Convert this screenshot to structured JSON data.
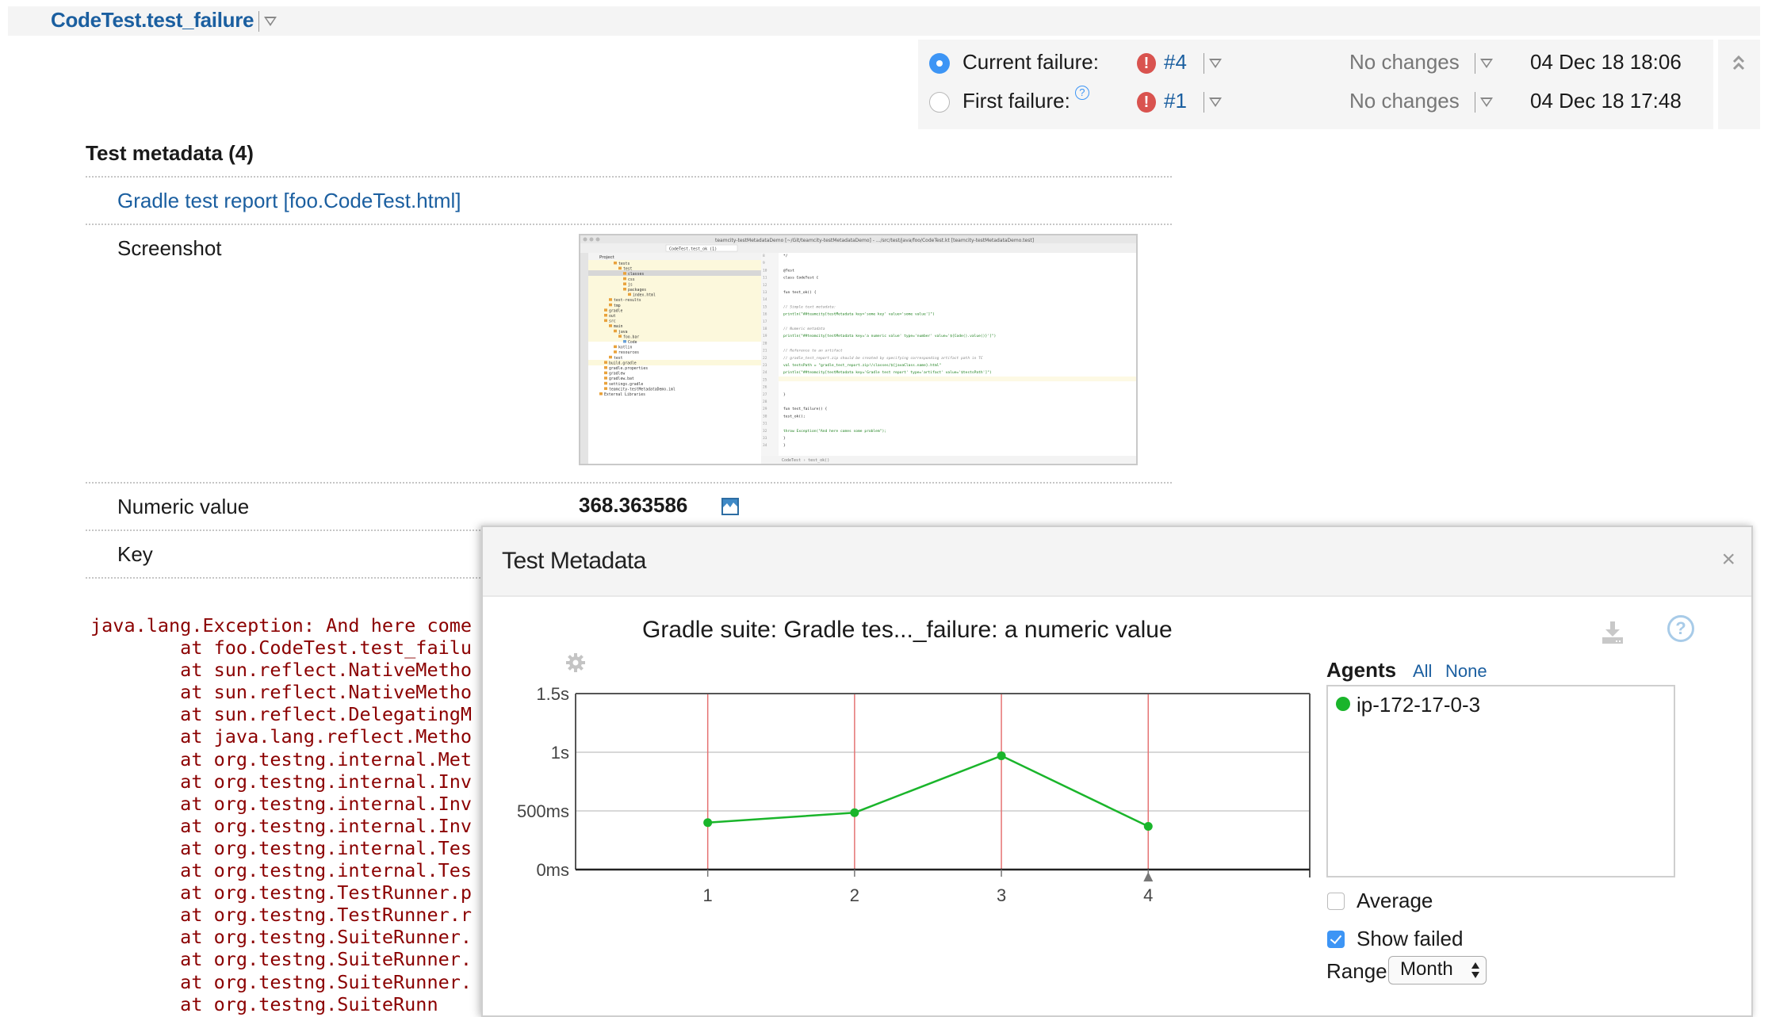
{
  "header": {
    "test_name": "CodeTest.test_failure"
  },
  "failures": {
    "rows": [
      {
        "label": "Current failure:",
        "selected": true,
        "has_help": false,
        "build": "#4",
        "changes": "No changes",
        "date": "04 Dec 18 18:06"
      },
      {
        "label": "First failure:",
        "selected": false,
        "has_help": true,
        "build": "#1",
        "changes": "No changes",
        "date": "04 Dec 18 17:48"
      }
    ],
    "help_glyph": "?",
    "error_glyph": "!"
  },
  "metadata": {
    "heading": "Test metadata (4)",
    "report_link": "Gradle test report [foo.CodeTest.html]",
    "screenshot_label": "Screenshot",
    "numeric_label": "Numeric value",
    "numeric_value": "368.363586",
    "key_label": "Key"
  },
  "stacktrace": {
    "lines": [
      "java.lang.Exception: And here come",
      "        at foo.CodeTest.test_failu",
      "        at sun.reflect.NativeMetho",
      "        at sun.reflect.NativeMetho",
      "        at sun.reflect.DelegatingM",
      "        at java.lang.reflect.Metho",
      "        at org.testng.internal.Met",
      "        at org.testng.internal.Inv",
      "        at org.testng.internal.Inv",
      "        at org.testng.internal.Inv",
      "        at org.testng.internal.Tes",
      "        at org.testng.internal.Tes",
      "        at org.testng.TestRunner.p",
      "        at org.testng.TestRunner.r",
      "        at org.testng.SuiteRunner.",
      "        at org.testng.SuiteRunner.",
      "        at org.testng.SuiteRunner.",
      "        at org.testng.SuiteRunn"
    ]
  },
  "dialog": {
    "title": "Test Metadata",
    "close_glyph": "×",
    "help_glyph": "?",
    "agents": {
      "label": "Agents",
      "all_link": "All",
      "none_link": "None",
      "items": [
        {
          "name": "ip-172-17-0-3",
          "color": "#1ab52b"
        }
      ]
    },
    "options": {
      "average_label": "Average",
      "average_checked": false,
      "show_failed_label": "Show failed",
      "show_failed_checked": true,
      "range_label": "Range",
      "range_value": "Month"
    }
  },
  "screenshot_thumb": {
    "window_title": "teamcity-testMetadataDemo [~/Git/teamcity-testMetadataDemo] - .../src/test/java/foo/CodeTest.kt [teamcity-testMetadataDemo.test]",
    "run_config": "CodeTest.test_ok (1)",
    "project_label": "Project",
    "tree": [
      "tests",
      "test",
      "classes",
      "css",
      "js",
      "packages",
      "index.html",
      "test-results",
      "tmp",
      "gradle",
      "out",
      "src",
      "main",
      "java",
      "foo.bar",
      "Code",
      "kotlin",
      "resources",
      "test",
      "build.gradle",
      "gradle.properties",
      "gradlew",
      "gradlew.bat",
      "settings.gradle",
      "teamcity-testMetadataDemo.iml",
      "External Libraries"
    ],
    "code": [
      "*/",
      "",
      "@Test",
      "class CodeTest {",
      "",
      "    fun test_ok() {",
      "",
      "        // Simple text metadata:",
      "        println(\"##teamcity[testMetadata key='some key' value='some value']\")",
      "",
      "        // Numeric metadata",
      "        println(\"##teamcity[testMetadata key='a numeric value' type='number' value='${Code().value()}']\")",
      "",
      "        // Reference to an artifact",
      "        // gradle_test_report.zip should be created by specifying corresponding artifact path in TC",
      "        val testsPath = \"gradle_test_report.zip!/classes/${javaClass.name}.html\"",
      "        println(\"##teamcity[testMetadata key='Gradle test report' type='artifact' value='$testsPath']\")",
      "",
      "",
      "    }",
      "",
      "    fun test_failure() {",
      "        test_ok();",
      "",
      "        throw Exception(\"And here comes some problem\");",
      "    }",
      "}"
    ],
    "line_start": 8,
    "breadcrumb": "CodeTest › test_ok()"
  },
  "chart_data": {
    "type": "line",
    "title": "Gradle suite: Gradle tes..._failure: a numeric value",
    "xlabel": "",
    "ylabel": "",
    "categories": [
      "1",
      "2",
      "3",
      "4"
    ],
    "series": [
      {
        "name": "ip-172-17-0-3",
        "color": "#1ab52b",
        "values": [
          400,
          485,
          970,
          368.363586
        ]
      }
    ],
    "failed_builds": [
      "1",
      "2",
      "3",
      "4"
    ],
    "failed_marker_color": "#e57373",
    "current_build": "4",
    "ylim": [
      0,
      1500
    ],
    "y_ticks": [
      {
        "value": 0,
        "label": "0ms"
      },
      {
        "value": 500,
        "label": "500ms"
      },
      {
        "value": 1000,
        "label": "1s"
      },
      {
        "value": 1500,
        "label": "1.5s"
      }
    ],
    "x_range": [
      0.1,
      5.1
    ],
    "grid": true,
    "legend": "none"
  }
}
